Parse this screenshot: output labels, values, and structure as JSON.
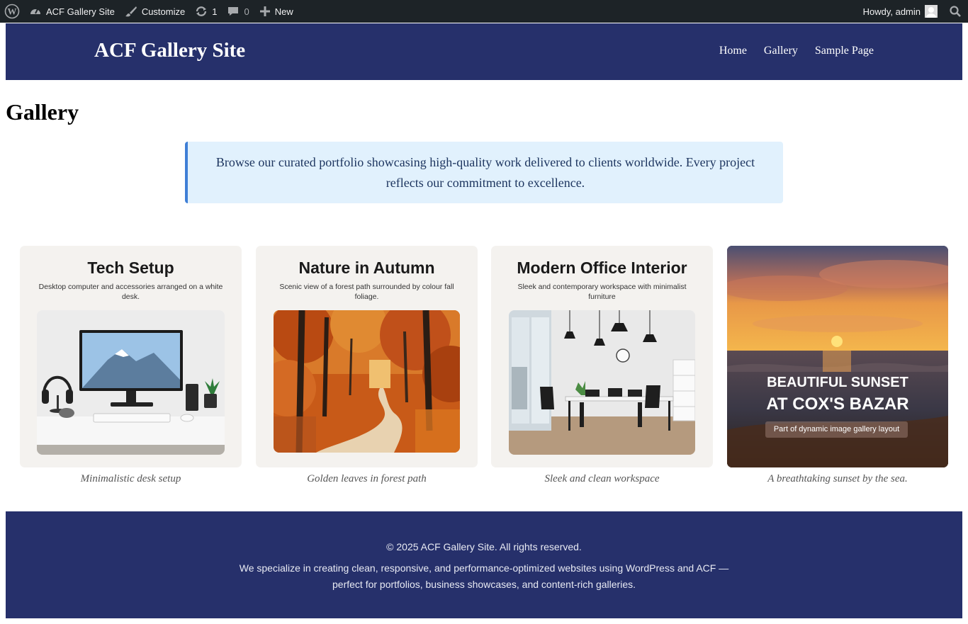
{
  "admin_bar": {
    "site_name": "ACF Gallery Site",
    "customize": "Customize",
    "updates_count": "1",
    "comments_count": "0",
    "new_label": "New",
    "greeting": "Howdy, admin"
  },
  "header": {
    "site_title": "ACF Gallery Site",
    "nav": [
      "Home",
      "Gallery",
      "Sample Page"
    ]
  },
  "page": {
    "title": "Gallery",
    "intro": "Browse our curated portfolio showcasing high-quality work delivered to clients worldwide. Every project reflects our commitment to excellence."
  },
  "gallery": [
    {
      "title": "Tech Setup",
      "description": "Desktop computer and accessories arranged on a white desk.",
      "caption": "Minimalistic desk setup",
      "icon": "desk-setup-image"
    },
    {
      "title": "Nature in Autumn",
      "description": "Scenic view of a forest path surrounded by colour fall foliage.",
      "caption": "Golden leaves in forest path",
      "icon": "autumn-forest-image"
    },
    {
      "title": "Modern Office Interior",
      "description": "Sleek and contemporary workspace with minimalist furniture",
      "caption": "Sleek and clean workspace",
      "icon": "office-interior-image"
    },
    {
      "title_line1": "BEAUTIFUL SUNSET",
      "title_line2": "AT COX'S BAZAR",
      "badge": "Part of dynamic image gallery layout",
      "caption": "A breathtaking sunset by the sea.",
      "icon": "sunset-image"
    }
  ],
  "footer": {
    "copyright": "© 2025 ACF Gallery Site. All rights reserved.",
    "about": "We specialize in creating clean, responsive, and performance-optimized websites using WordPress and ACF — perfect for portfolios, business showcases, and content-rich galleries."
  },
  "colors": {
    "admin_bar": "#1d2327",
    "header_bg": "#26306b",
    "intro_bg": "#e1f1fd",
    "intro_border": "#3f7fd6"
  }
}
